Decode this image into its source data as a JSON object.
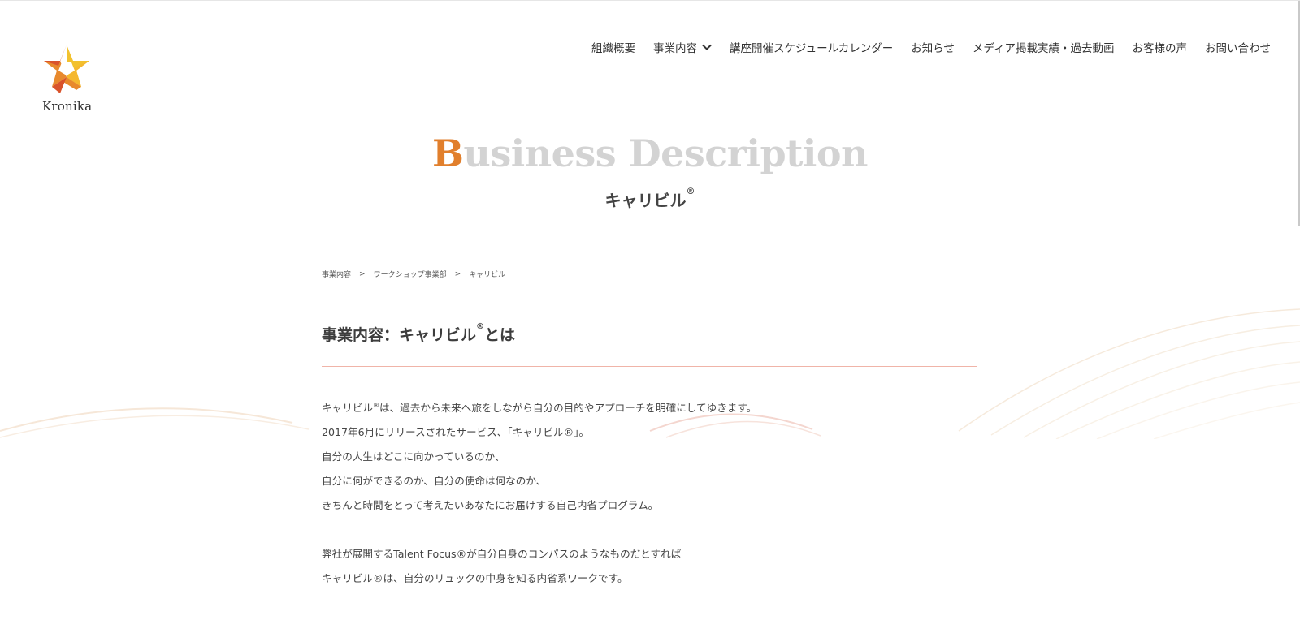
{
  "logo": {
    "text": "Kronika",
    "colors": {
      "yellow": "#f2c12e",
      "orange": "#e8892c",
      "red": "#d9532b"
    }
  },
  "nav": {
    "items": [
      {
        "label": "組織概要"
      },
      {
        "label": "事業内容",
        "has_dropdown": true
      },
      {
        "label": "講座開催スケジュールカレンダー"
      },
      {
        "label": "お知らせ"
      },
      {
        "label": "メディア掲載実績・過去動画"
      },
      {
        "label": "お客様の声"
      },
      {
        "label": "お問い合わせ"
      }
    ]
  },
  "hero": {
    "title_initial": "B",
    "title_rest": "usiness Description",
    "subtitle": "キャリビル",
    "subtitle_mark": "®",
    "colors": {
      "accent": "#e17f2c",
      "title_gray": "#d3d3d3"
    }
  },
  "breadcrumb": {
    "items": [
      "事業内容",
      "ワークショップ事業部",
      "キャリビル"
    ],
    "separator": ">"
  },
  "section": {
    "heading": "事業内容：キャリビル",
    "heading_mark": "®",
    "heading_suffix": "とは",
    "rule_color": "#f0b4a8"
  },
  "body": {
    "line1_a": "キャリビル",
    "line1_mark": "®",
    "line1_b": "は、過去から未来へ旅をしながら自分の目的やアプローチを明確にしてゆきます。",
    "line2": "2017年6月にリリースされたサービス、「キャリビル®」。",
    "line3": "自分の人生はどこに向かっているのか、",
    "line4": "自分に何ができるのか、自分の使命は何なのか、",
    "line5": "きちんと時間をとって考えたいあなたにお届けする自己内省プログラム。",
    "line6": "弊社が展開するTalent Focus®が自分自身のコンパスのようなものだとすれば",
    "line7": "キャリビル®は、自分のリュックの中身を知る内省系ワークです。"
  }
}
